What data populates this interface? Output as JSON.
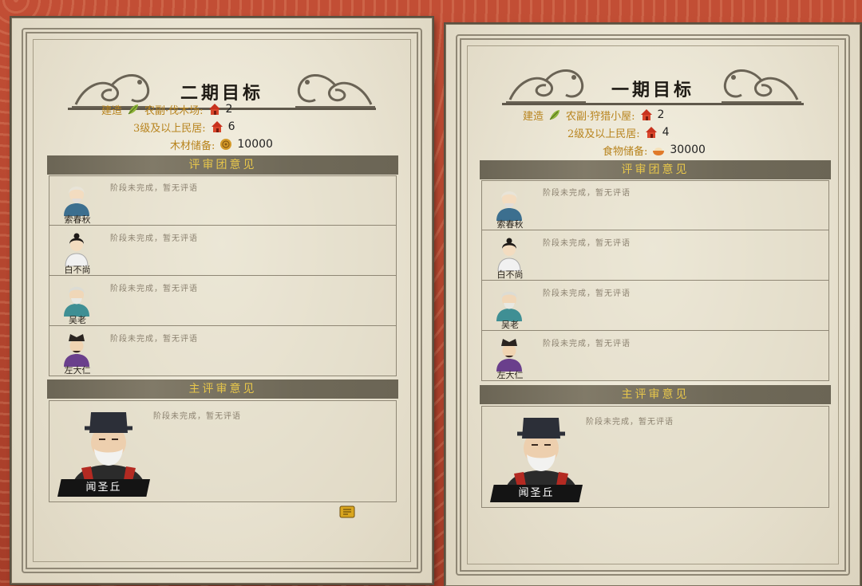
{
  "left_panel": {
    "title": "二期目标",
    "goals": [
      {
        "label": "建造",
        "label2": "农副·伐木场:",
        "icon": "house-icon",
        "value": "2"
      },
      {
        "label": "3级及以上民居:",
        "icon": "house-icon",
        "value": "6"
      },
      {
        "label": "木材储备:",
        "icon": "wood-icon",
        "value": "10000"
      }
    ],
    "jury_title": "评审团意见",
    "jury": [
      {
        "name": "索春秋",
        "comment": "阶段未完成，暂无评语"
      },
      {
        "name": "白不尚",
        "comment": "阶段未完成，暂无评语"
      },
      {
        "name": "吴老",
        "comment": "阶段未完成，暂无评语"
      },
      {
        "name": "左大仁",
        "comment": "阶段未完成，暂无评语"
      }
    ],
    "main_title": "主评审意见",
    "main_judge": {
      "name": "闻圣丘",
      "comment": "阶段未完成，暂无评语"
    }
  },
  "right_panel": {
    "title": "一期目标",
    "goals": [
      {
        "label": "建造",
        "label2": "农副·狩猎小屋:",
        "icon": "house-icon",
        "value": "2"
      },
      {
        "label": "2级及以上民居:",
        "icon": "house-icon",
        "value": "4"
      },
      {
        "label": "食物储备:",
        "icon": "food-icon",
        "value": "30000"
      }
    ],
    "jury_title": "评审团意见",
    "jury": [
      {
        "name": "索春秋",
        "comment": "阶段未完成，暂无评语"
      },
      {
        "name": "白不尚",
        "comment": "阶段未完成，暂无评语"
      },
      {
        "name": "吴老",
        "comment": "阶段未完成，暂无评语"
      },
      {
        "name": "左大仁",
        "comment": "阶段未完成，暂无评语"
      }
    ],
    "main_title": "主评审意见",
    "main_judge": {
      "name": "闻圣丘",
      "comment": "阶段未完成，暂无评语"
    }
  },
  "colors": {
    "goal_label": "#b8841e",
    "section_text": "#e7c64b",
    "background_red": "#b8442e"
  }
}
